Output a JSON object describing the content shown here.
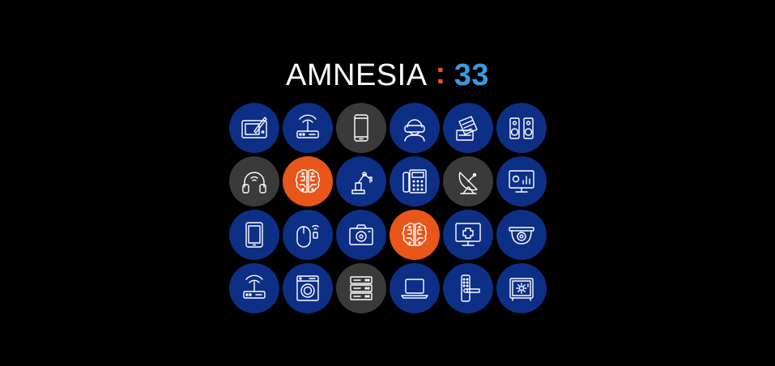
{
  "logo": {
    "word": "AMNESIA",
    "separator": ":",
    "number": "33"
  },
  "colors": {
    "background": "#000000",
    "wordmark": "#ffffff",
    "separator": "#e8541f",
    "number": "#3c9ae3",
    "tile_blue": "#0d2f86",
    "tile_gray": "#3a3a3a",
    "tile_orange": "#e8561a",
    "icon_stroke": "#ffffff"
  },
  "grid": [
    [
      {
        "icon": "drawing-tablet-icon",
        "color": "blue"
      },
      {
        "icon": "wifi-router-icon",
        "color": "blue"
      },
      {
        "icon": "smartphone-icon",
        "color": "gray"
      },
      {
        "icon": "vr-headset-person-icon",
        "color": "blue"
      },
      {
        "icon": "printer-documents-icon",
        "color": "blue"
      },
      {
        "icon": "speakers-icon",
        "color": "blue"
      }
    ],
    [
      {
        "icon": "wireless-headphones-icon",
        "color": "gray"
      },
      {
        "icon": "brain-circuit-icon",
        "color": "orange"
      },
      {
        "icon": "robotic-arm-icon",
        "color": "blue"
      },
      {
        "icon": "desk-phone-icon",
        "color": "blue"
      },
      {
        "icon": "satellite-dish-icon",
        "color": "gray"
      },
      {
        "icon": "presentation-monitor-icon",
        "color": "blue"
      }
    ],
    [
      {
        "icon": "tablet-icon",
        "color": "blue"
      },
      {
        "icon": "smart-mouse-icon",
        "color": "blue"
      },
      {
        "icon": "camera-icon",
        "color": "blue"
      },
      {
        "icon": "brain-circuit-icon",
        "color": "orange"
      },
      {
        "icon": "medical-monitor-icon",
        "color": "blue"
      },
      {
        "icon": "security-camera-icon",
        "color": "blue"
      }
    ],
    [
      {
        "icon": "wifi-router-icon",
        "color": "blue"
      },
      {
        "icon": "washing-machine-icon",
        "color": "blue"
      },
      {
        "icon": "server-rack-icon",
        "color": "gray"
      },
      {
        "icon": "laptop-icon",
        "color": "blue"
      },
      {
        "icon": "smart-door-lock-icon",
        "color": "blue"
      },
      {
        "icon": "smart-safe-icon",
        "color": "blue"
      }
    ]
  ]
}
